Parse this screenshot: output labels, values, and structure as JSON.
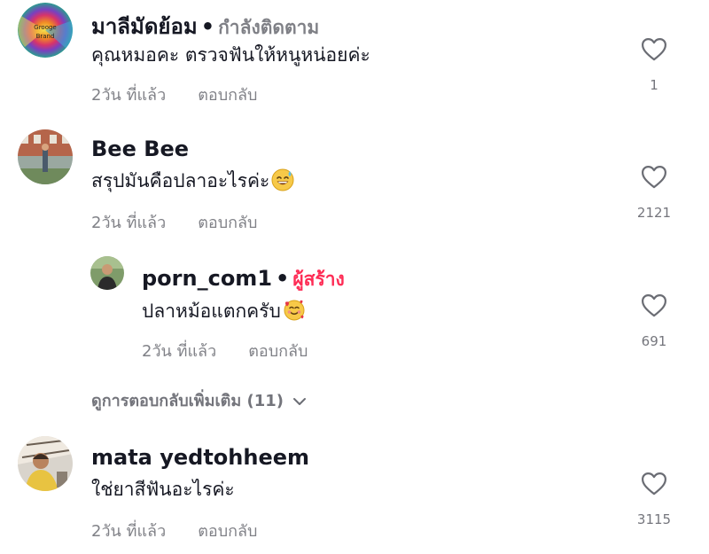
{
  "comments": [
    {
      "username": "มาลีมัดย้อม",
      "tag": "กำลังติดตาม",
      "text": "คุณหมอคะ ตรวจฟันให้หนูหน่อยค่ะ",
      "time": "2วัน ที่แล้ว",
      "reply_label": "ตอบกลับ",
      "likes": "1",
      "avatar_text": "Grooge Brand"
    },
    {
      "username": "Bee Bee",
      "text": "สรุปมันคือปลาอะไรค่ะ",
      "emoji": "sweat-smile",
      "time": "2วัน ที่แล้ว",
      "reply_label": "ตอบกลับ",
      "likes": "2121"
    },
    {
      "username": "porn_com1",
      "tag": "ผู้สร้าง",
      "tag_color": "#fe2c55",
      "text": "ปลาหม้อแตกครับ",
      "emoji": "smiling-face-with-hearts",
      "time": "2วัน ที่แล้ว",
      "reply_label": "ตอบกลับ",
      "likes": "691"
    },
    {
      "username": "mata yedtohheem",
      "text": "ใช่ยาสีฟันอะไรค่ะ",
      "time": "2วัน ที่แล้ว",
      "reply_label": "ตอบกลับ",
      "likes": "3115"
    }
  ],
  "view_more": "ดูการตอบกลับเพิ่มเติม (11)",
  "colors": {
    "text": "#161823",
    "secondary": "rgba(22,24,35,0.55)",
    "creator": "#fe2c55"
  }
}
